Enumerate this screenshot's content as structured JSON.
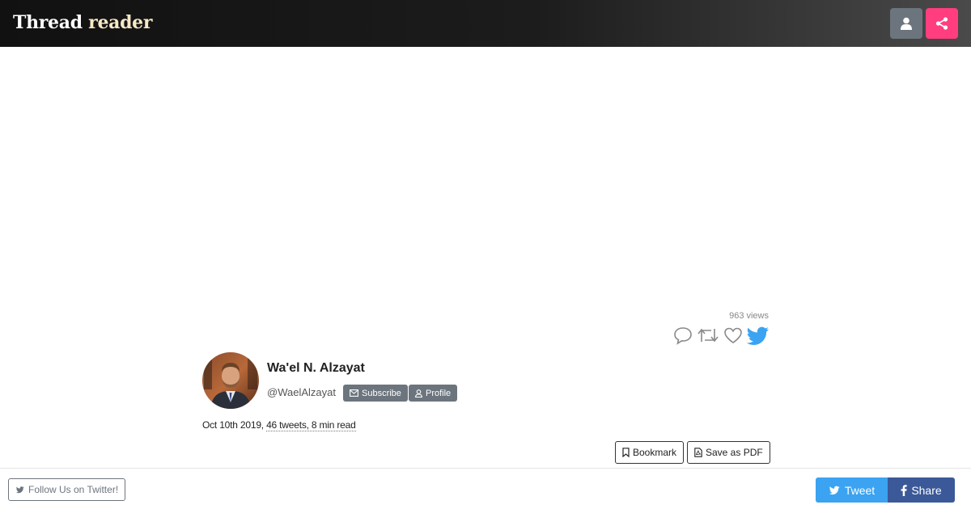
{
  "header": {
    "brand_part1": "Thread",
    "brand_part2": "reader",
    "user_icon": "user-icon",
    "share_icon": "share-icon"
  },
  "thread": {
    "views": "963 views",
    "action_icons": [
      "reply-icon",
      "retweet-icon",
      "like-icon",
      "twitter-bird-icon"
    ],
    "author_name": "Wa'el N. Alzayat",
    "handle": "@WaelAlzayat",
    "subscribe_label": "Subscribe",
    "profile_label": "Profile",
    "date": "Oct 10th 2019,",
    "stats": "46 tweets, 8 min read",
    "bookmark_label": "Bookmark",
    "save_pdf_label": "Save as PDF"
  },
  "footer": {
    "follow_label": "Follow Us on Twitter!",
    "tweet_label": "Tweet",
    "share_label": "Share"
  },
  "colors": {
    "header_dark": "#111111",
    "share_pink": "#ff3d7f",
    "gray_button": "#6c757d",
    "twitter_blue": "#3ba3f1",
    "facebook_blue": "#3b5998"
  }
}
